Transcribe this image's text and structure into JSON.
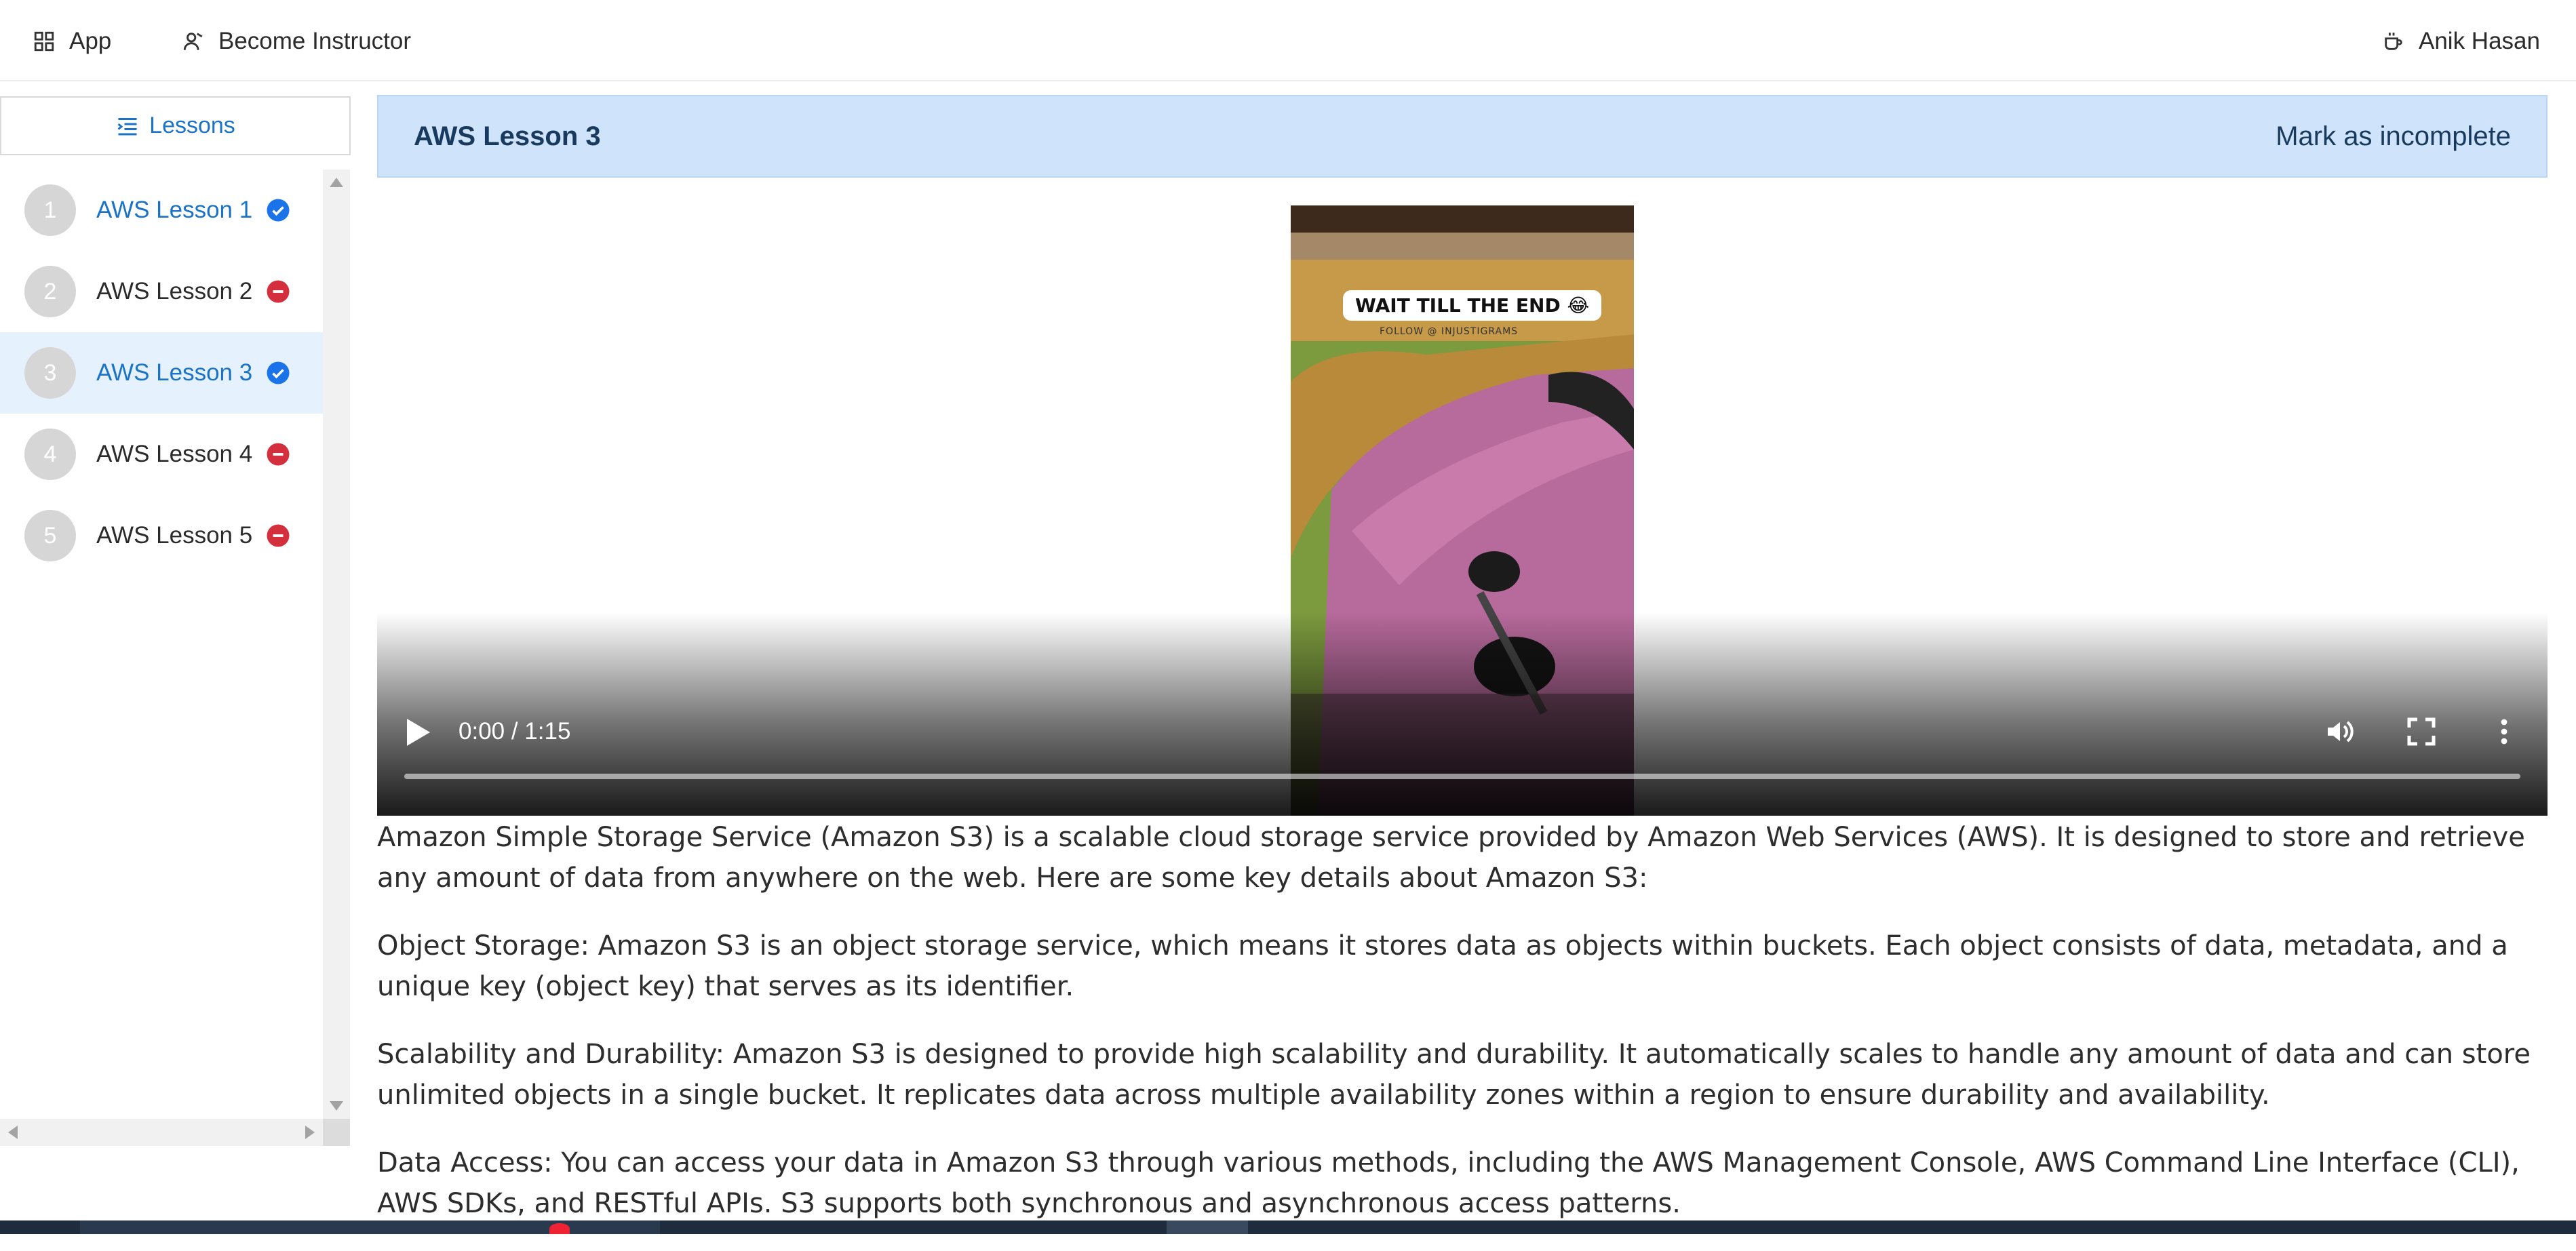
{
  "topnav": {
    "app_label": "App",
    "instructor_label": "Become Instructor",
    "user_name": "Anik Hasan"
  },
  "sidebar": {
    "tab_label": "Lessons",
    "lessons": [
      {
        "number": "1",
        "title": "AWS Lesson 1",
        "status": "complete"
      },
      {
        "number": "2",
        "title": "AWS Lesson 2",
        "status": "incomplete"
      },
      {
        "number": "3",
        "title": "AWS Lesson 3",
        "status": "complete"
      },
      {
        "number": "4",
        "title": "AWS Lesson 4",
        "status": "incomplete"
      },
      {
        "number": "5",
        "title": "AWS Lesson 5",
        "status": "incomplete"
      }
    ]
  },
  "lesson": {
    "title": "AWS Lesson 3",
    "mark_label": "Mark as incomplete"
  },
  "video": {
    "caption": "WAIT TILL THE END 😂",
    "caption_sub": "FOLLOW @ INJUSTIGRAMS",
    "time": "0:00 / 1:15",
    "progress_fraction": 0
  },
  "content": {
    "paragraphs": [
      "Amazon Simple Storage Service (Amazon S3) is a scalable cloud storage service provided by Amazon Web Services (AWS). It is designed to store and retrieve any amount of data from anywhere on the web. Here are some key details about Amazon S3:",
      "Object Storage: Amazon S3 is an object storage service, which means it stores data as objects within buckets. Each object consists of data, metadata, and a unique key (object key) that serves as its identifier.",
      "Scalability and Durability: Amazon S3 is designed to provide high scalability and durability. It automatically scales to handle any amount of data and can store unlimited objects in a single bucket. It replicates data across multiple availability zones within a region to ensure durability and availability.",
      "Data Access: You can access your data in Amazon S3 through various methods, including the AWS Management Console, AWS Command Line Interface (CLI), AWS SDKs, and RESTful APIs. S3 supports both synchronous and asynchronous access patterns."
    ]
  },
  "colors": {
    "accent": "#1a73c7",
    "header_bg": "#cfe4fa",
    "complete": "#1a73e8",
    "incomplete": "#d32f3c",
    "active_row": "#e5f2fd"
  },
  "icons": {
    "app": "grid-icon",
    "instructor": "user-teach-icon",
    "user": "coffee-cup-icon",
    "lessons": "list-indent-icon",
    "complete": "check-circle-icon",
    "incomplete": "minus-circle-icon"
  }
}
